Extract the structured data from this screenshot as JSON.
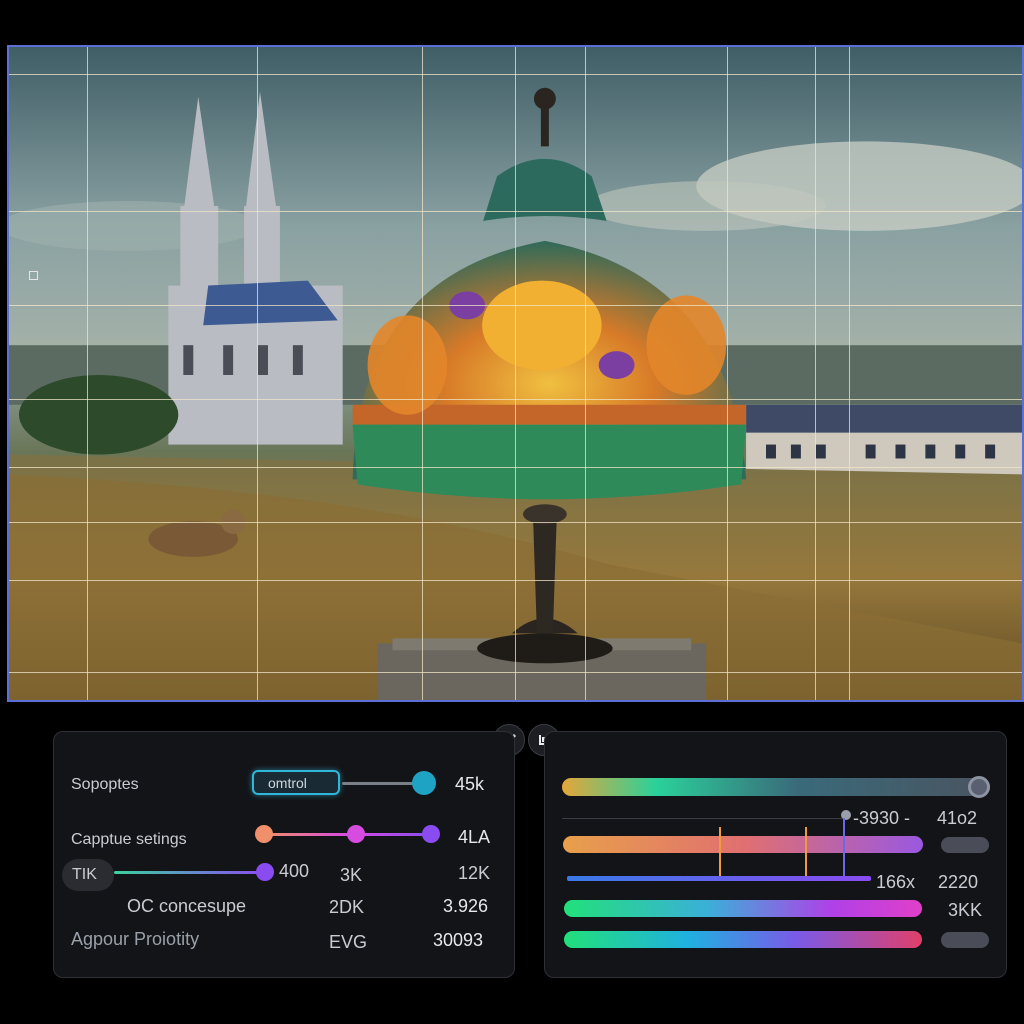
{
  "viewport": {
    "accent": "#5b6fd6",
    "grid": {
      "columns": 10,
      "rows": 8
    }
  },
  "toolbar": {
    "icons": [
      "brush-icon",
      "crop-icon"
    ]
  },
  "left_panel": {
    "row1": {
      "label": "Sopoptes",
      "field_value": "omtrol",
      "value": "45k"
    },
    "row2": {
      "label": "Capptue setings",
      "value": "4LA"
    },
    "row3": {
      "chip": "TIK",
      "value1": "400",
      "value2": "3K",
      "value3": "12K"
    },
    "row4": {
      "label": "OC concesupe",
      "value1": "2DK",
      "value2": "3.926"
    },
    "row5": {
      "label": "Agpour Proiotity",
      "value1": "EVG",
      "value2": "30093"
    },
    "colors": {
      "teal": "#1fa3c4",
      "pink": "#d64be0",
      "purple": "#8a4cf0",
      "orange": "#f0906a"
    }
  },
  "right_panel": {
    "readout1": "-3930 -",
    "readout2": "41o2",
    "readout3": "166x",
    "readout4": "2220",
    "readout5": "3KK",
    "levels": {
      "top_slider": 1.0,
      "bar_orange": 0.86,
      "bar_green": 1.0,
      "bar_rainbow": 1.0
    }
  }
}
